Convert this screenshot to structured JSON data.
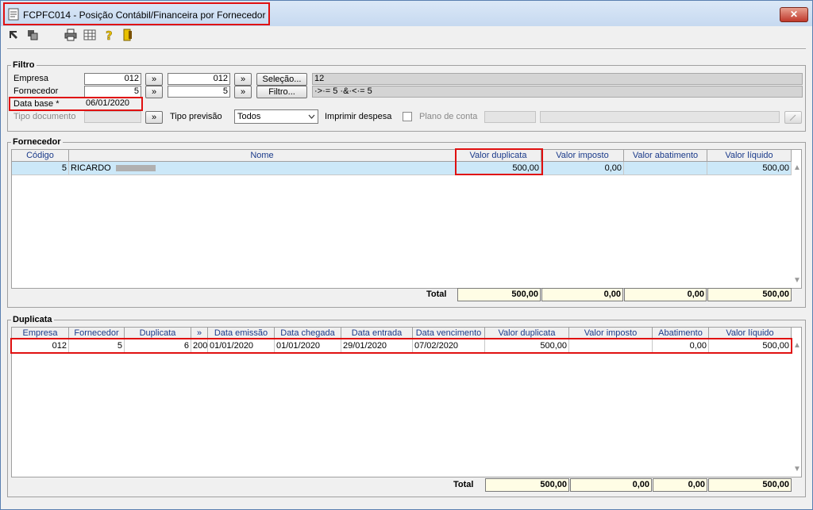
{
  "window": {
    "title": "FCPFC014 - Posição Contábil/Financeira por Fornecedor",
    "close_label": "✕"
  },
  "toolbar": {
    "icons": [
      "back-arrow-icon",
      "layers-icon",
      "printer-icon",
      "calculator-icon",
      "help-icon",
      "exit-door-icon"
    ]
  },
  "filtro": {
    "legend": "Filtro",
    "empresa": {
      "label": "Empresa",
      "from": "012",
      "to": "012",
      "btn": "»",
      "btn2": "»"
    },
    "fornecedor": {
      "label": "Fornecedor",
      "from": "5",
      "to": "5",
      "btn": "»",
      "btn2": "»"
    },
    "selecao_label": "Seleção...",
    "selecao_value": "12",
    "filtro_label": "Filtro...",
    "filtro_value": "·>·= 5 ·&·<·= 5",
    "data_base": {
      "label": "Data base *",
      "value": "06/01/2020"
    },
    "tipo_documento": {
      "label": "Tipo documento",
      "btn": "»"
    },
    "tipo_previsao": {
      "label": "Tipo previsão",
      "value": "Todos"
    },
    "imprimir_despesa": "Imprimir despesa",
    "plano_conta": "Plano de conta"
  },
  "fornecedor_grid": {
    "legend": "Fornecedor",
    "headers": [
      "Código",
      "Nome",
      "Valor duplicata",
      "Valor imposto",
      "Valor abatimento",
      "Valor líquido"
    ],
    "row": {
      "codigo": "5",
      "nome": "RICARDO",
      "valor_duplicata": "500,00",
      "valor_imposto": "0,00",
      "valor_abatimento": "",
      "valor_liquido": "500,00"
    },
    "total_label": "Total",
    "totals": [
      "500,00",
      "0,00",
      "0,00",
      "500,00"
    ]
  },
  "duplicata_grid": {
    "legend": "Duplicata",
    "headers": [
      "Empresa",
      "Fornecedor",
      "Duplicata",
      "»",
      "Data emissão",
      "Data chegada",
      "Data entrada",
      "Data vencimento",
      "Valor duplicata",
      "Valor imposto",
      "Abatimento",
      "Valor líquido"
    ],
    "row": [
      "012",
      "5",
      "6",
      "200",
      "01/01/2020",
      "01/01/2020",
      "29/01/2020",
      "07/02/2020",
      "500,00",
      "",
      "0,00",
      "500,00"
    ],
    "total_label": "Total",
    "totals": [
      "500,00",
      "0,00",
      "0,00",
      "500,00"
    ]
  },
  "colors": {
    "highlight": "#e01010",
    "selected_row": "#cce8f8",
    "total_bg": "#fffde5",
    "header_text": "#1a3a8a"
  }
}
